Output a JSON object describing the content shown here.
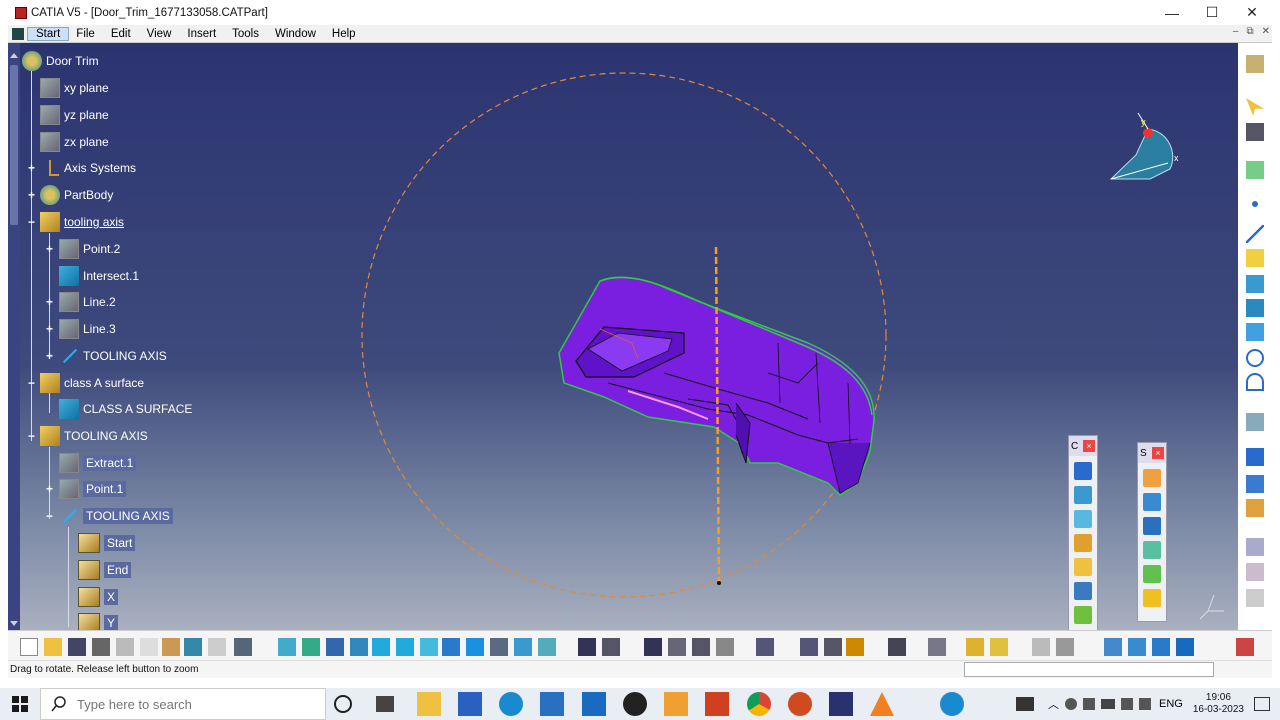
{
  "window": {
    "title": "CATIA V5 - [Door_Trim_1677133058.CATPart]",
    "minimize": "—",
    "maximize": "☐",
    "close": "✕"
  },
  "menu": {
    "items": [
      "Start",
      "File",
      "Edit",
      "View",
      "Insert",
      "Tools",
      "Window",
      "Help"
    ],
    "doc_controls": [
      "–",
      "⧉",
      "✕"
    ]
  },
  "tree": {
    "root": "Door Trim",
    "nodes": [
      {
        "label": "xy plane"
      },
      {
        "label": "yz plane"
      },
      {
        "label": "zx plane"
      },
      {
        "label": "Axis Systems"
      },
      {
        "label": "PartBody"
      },
      {
        "label": "tooling axis"
      },
      {
        "label": "Point.2"
      },
      {
        "label": "Intersect.1"
      },
      {
        "label": "Line.2"
      },
      {
        "label": "Line.3"
      },
      {
        "label": "TOOLING AXIS"
      },
      {
        "label": "class A surface"
      },
      {
        "label": "CLASS A SURFACE"
      },
      {
        "label": "TOOLING AXIS"
      },
      {
        "label": "Extract.1"
      },
      {
        "label": "Point.1"
      },
      {
        "label": "TOOLING AXIS"
      },
      {
        "label": "Start"
      },
      {
        "label": "End"
      },
      {
        "label": "X"
      },
      {
        "label": "Y"
      }
    ]
  },
  "compass": {
    "x_label": "x",
    "y_label": "y"
  },
  "floating_toolbars": [
    {
      "title": "C",
      "close": "×"
    },
    {
      "title": "S",
      "close": "×"
    }
  ],
  "status": {
    "message": "Drag to rotate. Release left button to zoom"
  },
  "taskbar": {
    "search_placeholder": "Type here to search",
    "language": "ENG",
    "time": "19:06",
    "date": "16-03-2023"
  },
  "colors": {
    "viewport_top": "#2c3470",
    "viewport_bottom": "#a9b0bf",
    "part_fill": "#7a1ee0",
    "part_edge": "#2ecc40",
    "axis_line": "#ff9a1a",
    "rotation_circle": "#e08a3a"
  }
}
